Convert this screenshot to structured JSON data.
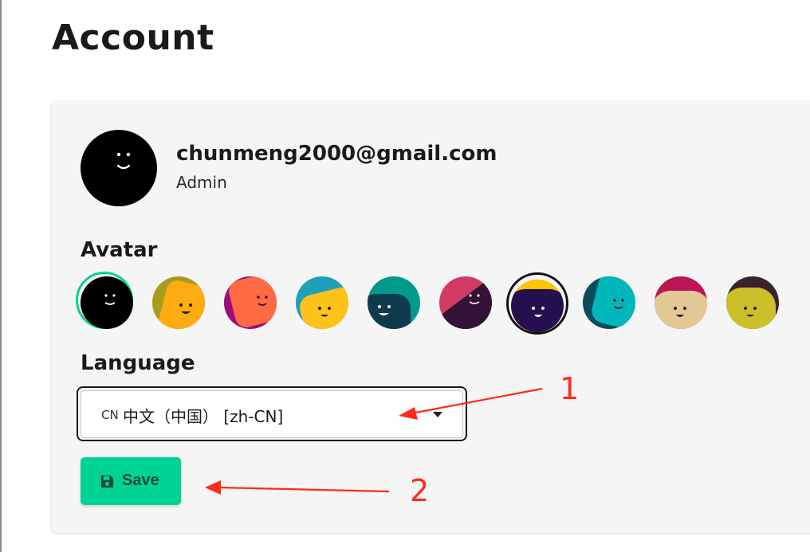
{
  "page": {
    "title": "Account"
  },
  "profile": {
    "email": "chunmeng2000@gmail.com",
    "role": "Admin"
  },
  "avatar_section": {
    "label": "Avatar",
    "options": [
      {
        "name": "black"
      },
      {
        "name": "orange-olive"
      },
      {
        "name": "coral-magenta"
      },
      {
        "name": "yellow-teal"
      },
      {
        "name": "navy-teal"
      },
      {
        "name": "plum-crimson"
      },
      {
        "name": "purple-gold"
      },
      {
        "name": "teal-dark"
      },
      {
        "name": "tan-crimson"
      },
      {
        "name": "olive-brown"
      }
    ]
  },
  "language_section": {
    "label": "Language",
    "flag": "CN",
    "selected": "中文（中国） [zh-CN]"
  },
  "save_button": {
    "label": "Save",
    "icon": "floppy-disk-icon"
  },
  "annotations": {
    "marker1": "1",
    "marker2": "2",
    "color": "#ff2a1a"
  },
  "colors": {
    "accent": "#00d494",
    "card_bg": "#f5f5f5",
    "selected_ring": "#00d494"
  }
}
